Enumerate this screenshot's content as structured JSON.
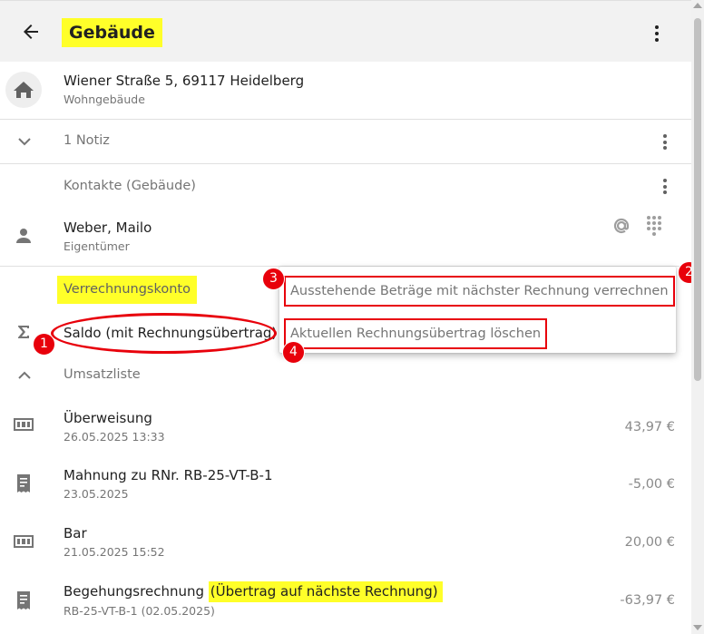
{
  "header": {
    "title": "Gebäude"
  },
  "building": {
    "address": "Wiener Straße 5, 69117 Heidelberg",
    "type": "Wohngebäude"
  },
  "notes": {
    "label": "1 Notiz"
  },
  "contacts": {
    "section_label": "Kontakte (Gebäude)",
    "items": [
      {
        "name": "Weber, Mailo",
        "role": "Eigentümer"
      }
    ]
  },
  "account": {
    "section_label": "Verrechnungskonto",
    "balance_label": "Saldo (mit Rechnungsübertrag)"
  },
  "context_menu": {
    "items": [
      {
        "label": "Ausstehende Beträge mit nächster Rechnung verrechnen"
      },
      {
        "label": "Aktuellen Rechnungsübertrag löschen"
      }
    ]
  },
  "annotations": {
    "badges": [
      "1",
      "2",
      "3",
      "4"
    ],
    "color": "#e8000b",
    "highlight_color": "#ffff29"
  },
  "transactions": {
    "section_label": "Umsatzliste",
    "items": [
      {
        "title": "Überweisung",
        "title_extra": "",
        "subtitle": "26.05.2025 13:33",
        "amount": "43,97 €",
        "icon": "cash-icon"
      },
      {
        "title": "Mahnung zu RNr. RB-25-VT-B-1",
        "title_extra": "",
        "subtitle": "23.05.2025",
        "amount": "-5,00 €",
        "icon": "receipt-icon"
      },
      {
        "title": "Bar",
        "title_extra": "",
        "subtitle": "21.05.2025 15:52",
        "amount": "20,00 €",
        "icon": "cash-icon"
      },
      {
        "title": "Begehungsrechnung ",
        "title_extra": "(Übertrag auf nächste Rechnung)",
        "subtitle": "RB-25-VT-B-1 (02.05.2025)",
        "amount": "-63,97 €",
        "icon": "receipt-icon"
      }
    ]
  }
}
